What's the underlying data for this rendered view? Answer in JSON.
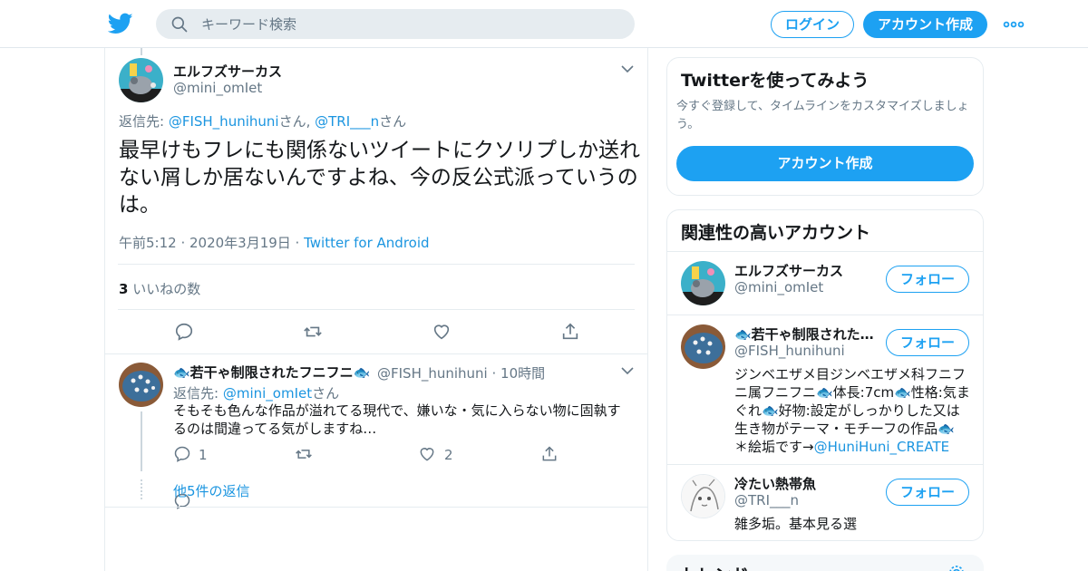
{
  "header": {
    "search_placeholder": "キーワード検索",
    "login_label": "ログイン",
    "signup_label": "アカウント作成",
    "brand_color": "#1da1f2"
  },
  "tweet": {
    "author_name": "エルフズサーカス",
    "author_handle": "@mini_omIet",
    "reply_prefix": "返信先: ",
    "reply_to_1": "@FISH_hunihuni",
    "reply_sep_1": "さん, ",
    "reply_to_2": "@TRI___n",
    "reply_sep_2": "さん",
    "text": "最早けもフレにも関係ないツイートにクソリプしか送れない屑しか居ないんですよね、今の反公式派っていうのは。",
    "time": "午前5:12 · 2020年3月19日 · ",
    "client": "Twitter for Android",
    "likes_count": "3",
    "likes_label": " いいねの数"
  },
  "reply": {
    "author_name": "🐟若干ゃ制限されたフニフニ🐟",
    "author_handle": "@FISH_hunihuni · 10時間",
    "reply_prefix": "返信先: ",
    "reply_to": "@mini_omIet",
    "reply_suffix": "さん",
    "text": "そもそも色んな作品が溢れてる現代で、嫌いな・気に入らない物に固執するのは間違ってる気がしますね…",
    "reply_count": "1",
    "like_count": "2",
    "more_replies": "他5件の返信"
  },
  "sidebar": {
    "try_card": {
      "title": "Twitterを使ってみよう",
      "subtitle": "今すぐ登録して、タイムラインをカスタマイズしましょう。",
      "cta": "アカウント作成"
    },
    "related": {
      "title": "関連性の高いアカウント",
      "follow_label": "フォロー",
      "accounts": [
        {
          "name": "エルフズサーカス",
          "handle": "@mini_omIet",
          "bio": "",
          "bio_link": ""
        },
        {
          "name": "🐟若干ゃ制限された…",
          "handle": "@FISH_hunihuni",
          "bio": "ジンベエザメ目ジンベエザメ科フニフニ属フニフニ🐟体長:7cm🐟性格:気まぐれ🐟好物:設定がしっかりした又は生き物がテーマ・モチーフの作品🐟 ＊絵垢です→",
          "bio_link": "@HuniHuni_CREATE"
        },
        {
          "name": "冷たい熱帯魚",
          "handle": "@TRI___n",
          "bio": "雑多垢。基本見る選",
          "bio_link": ""
        }
      ]
    },
    "trends": {
      "title": "トレンド"
    }
  }
}
